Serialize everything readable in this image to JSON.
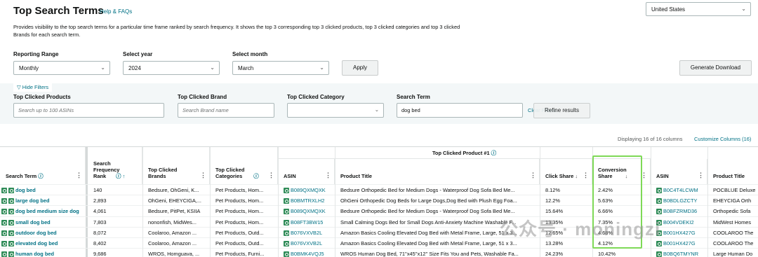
{
  "header": {
    "title": "Top Search Terms",
    "help_link": "Help & FAQs",
    "description": "Provides visibility to the top search terms for a particular time frame ranked by search frequency. It shows the top 3 corresponding top 3 clicked products, top 3 clicked categories and top 3 clicked Brands for each search term.",
    "country": "United States"
  },
  "controls": {
    "range_label": "Reporting Range",
    "range_value": "Monthly",
    "year_label": "Select year",
    "year_value": "2024",
    "month_label": "Select month",
    "month_value": "March",
    "apply": "Apply",
    "generate": "Generate Download"
  },
  "filters": {
    "hide": "Hide Filters",
    "products_label": "Top Clicked Products",
    "products_placeholder": "Search up to 100 ASINs",
    "brand_label": "Top Clicked Brand",
    "brand_placeholder": "Search Brand name",
    "category_label": "Top Clicked Category",
    "category_value": "",
    "term_label": "Search Term",
    "term_value": "dog bed",
    "clear": "Clear Filters",
    "refine": "Refine results"
  },
  "table_meta": {
    "displaying": "Displaying 16 of 16 columns",
    "customize": "Customize Columns (16)",
    "group_title": "Top Clicked Product #1"
  },
  "columns": {
    "search_term": "Search Term",
    "sfr_line1": "Search",
    "sfr_line2": "Frequency",
    "sfr_line3": "Rank",
    "brands_line1": "Top Clicked",
    "brands_line2": "Brands",
    "cats_line1": "Top Clicked",
    "cats_line2": "Categories",
    "asin": "ASIN",
    "product_title": "Product Title",
    "click_share": "Click Share",
    "conv_line1": "Conversion",
    "conv_line2": "Share",
    "asin2": "ASIN",
    "product_title2": "Product Title"
  },
  "rows": [
    {
      "term": "dog bed",
      "rank": "140",
      "brands": "Bedsure, OhGeni, K...",
      "cats": "Pet Products, Hom...",
      "asin": "B089QXMQXK",
      "title": "Bedsure Orthopedic Bed for Medium Dogs - Waterproof Dog Sofa Bed Me...",
      "click": "8.12%",
      "conv": "2.42%",
      "asin2": "B0C4T4LCWM",
      "title2": "POCBLUE Deluxe"
    },
    {
      "term": "large dog bed",
      "rank": "2,893",
      "brands": "OhGeni, EHEYCIGA,...",
      "cats": "Pet Products, Hom...",
      "asin": "B0BMTRXLH2",
      "title": "OhGeni Orthopedic Dog Beds for Large Dogs,Dog Bed with Plush Egg Foa...",
      "click": "12.2%",
      "conv": "5.63%",
      "asin2": "B0BDLGZCTY",
      "title2": "EHEYCIGA Orth"
    },
    {
      "term": "dog bed medium size dog",
      "rank": "4,061",
      "brands": "Bedsure, PitPet, KSIIA",
      "cats": "Pet Products, Hom...",
      "asin": "B089QXMQXK",
      "title": "Bedsure Orthopedic Bed for Medium Dogs - Waterproof Dog Sofa Bed Me...",
      "click": "15.64%",
      "conv": "6.66%",
      "asin2": "B0BFZRMD36",
      "title2": "Orthopedic Sofa"
    },
    {
      "term": "small dog bed",
      "rank": "7,803",
      "brands": "nononfish, MidWes...",
      "cats": "Pet Products, Hom...",
      "asin": "B08FT3BW15",
      "title": "Small Calming Dogs Bed for Small Dogs Anti-Anxiety Machine Washable F...",
      "click": "13.35%",
      "conv": "7.35%",
      "asin2": "B004VDEKI2",
      "title2": "MidWest Homes"
    },
    {
      "term": "outdoor dog bed",
      "rank": "8,072",
      "brands": "Coolaroo, Amazon ...",
      "cats": "Pet Products, Outd...",
      "asin": "B076VXVB2L",
      "title": "Amazon Basics Cooling Elevated Dog Bed with Metal Frame, Large, 51 x 3...",
      "click": "12.65%",
      "conv": "4.68%",
      "asin2": "B001HX427G",
      "title2": "COOLAROO The"
    },
    {
      "term": "elevated dog bed",
      "rank": "8,402",
      "brands": "Coolaroo, Amazon ...",
      "cats": "Pet Products, Outd...",
      "asin": "B076VXVB2L",
      "title": "Amazon Basics Cooling Elevated Dog Bed with Metal Frame, Large, 51 x 3...",
      "click": "13.28%",
      "conv": "4.12%",
      "asin2": "B001HX427G",
      "title2": "COOLAROO The"
    },
    {
      "term": "human dog bed",
      "rank": "9,686",
      "brands": "WROS, Homguava, ...",
      "cats": "Pet Products, Furni...",
      "asin": "B0BMK4VQJ5",
      "title": "WROS Human Dog Bed, 71''x45''x12'' Size Fits You and Pets, Washable Fa...",
      "click": "24.23%",
      "conv": "10.42%",
      "asin2": "B0BQ6TMYNR",
      "title2": "Large Human Do"
    }
  ],
  "watermark": "公众号 · moningzi",
  "colors": {
    "link": "#007185",
    "highlight": "#7ed957",
    "filter_band": "#f3f7f8"
  }
}
